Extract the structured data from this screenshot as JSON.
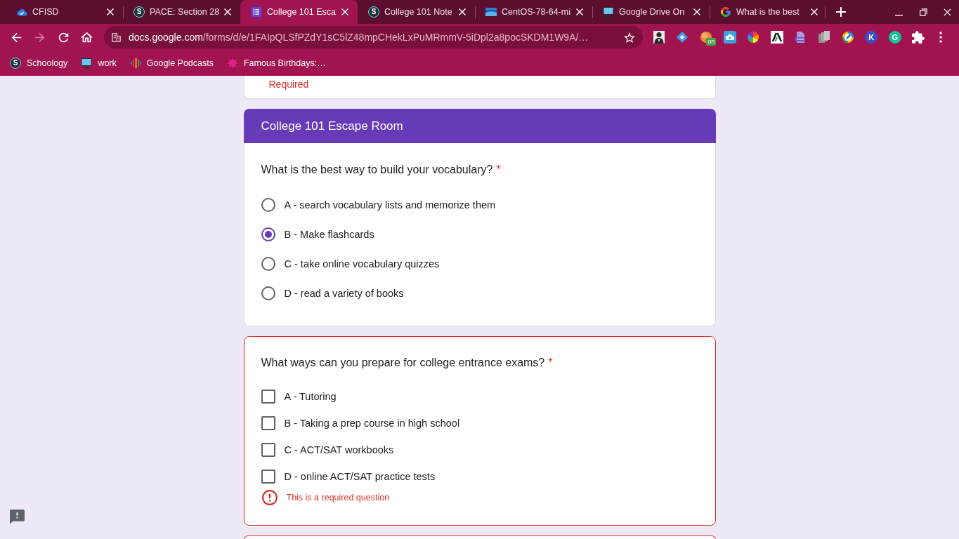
{
  "browser": {
    "tabs": [
      {
        "title": "CFISD",
        "kind": "cloud",
        "selected": false
      },
      {
        "title": "PACE: Section 28",
        "kind": "letter",
        "glyph": "S",
        "selected": false
      },
      {
        "title": "College 101 Esca",
        "kind": "list",
        "selected": true
      },
      {
        "title": "College 101 Note",
        "kind": "letter",
        "glyph": "S",
        "selected": false
      },
      {
        "title": "CentOS-78-64-mi",
        "kind": "landscape",
        "selected": false
      },
      {
        "title": "Google Drive On",
        "kind": "monitor",
        "selected": false
      },
      {
        "title": "What is the best",
        "kind": "g-logo",
        "selected": false
      }
    ],
    "nav_buttons": [
      {
        "kind": "back",
        "disabled": false
      },
      {
        "kind": "forward",
        "disabled": true
      },
      {
        "kind": "reload",
        "disabled": false
      },
      {
        "kind": "home",
        "disabled": false
      }
    ],
    "address": {
      "host": "docs.google.com",
      "path": "/forms/d/e/1FAIpQLSfPZdY1sC5lZ48mpCHekLxPuMRmmV-5iDpl2a8pocSKDM1W9A/…"
    },
    "extensions": [
      {
        "kind": "mascot"
      },
      {
        "kind": "diamond"
      },
      {
        "kind": "orb",
        "badge": "on"
      },
      {
        "kind": "cloud"
      },
      {
        "kind": "wheel"
      },
      {
        "kind": "peak"
      },
      {
        "kind": "document"
      },
      {
        "kind": "pages"
      },
      {
        "kind": "pencil"
      },
      {
        "kind": "letter",
        "glyph": "K",
        "color": "#3b4fc4"
      },
      {
        "kind": "letter",
        "glyph": "G",
        "color": "#15c39a"
      }
    ],
    "bookmarks": [
      {
        "label": "Schoology",
        "kind": "letter",
        "glyph": "S"
      },
      {
        "label": "work",
        "kind": "monitor"
      },
      {
        "label": "Google Podcasts",
        "kind": "bars"
      },
      {
        "label": "Famous Birthdays:…",
        "kind": "burst"
      }
    ]
  },
  "form": {
    "previous_card": {
      "note": "Required"
    },
    "questions": [
      {
        "kind": "radio",
        "section_title": "College 101 Escape Room",
        "title": "What is the best way to build your vocabulary?",
        "required_mark": "*",
        "invalid": false,
        "options": [
          {
            "label": "A - search vocabulary lists and memorize them",
            "selected": false
          },
          {
            "label": "B - Make flashcards",
            "selected": true
          },
          {
            "label": "C - take online vocabulary quizzes",
            "selected": false
          },
          {
            "label": "D - read a variety of books",
            "selected": false
          }
        ]
      },
      {
        "kind": "checkbox",
        "title": "What ways can you prepare for college entrance exams?",
        "required_mark": "*",
        "invalid": true,
        "error": "This is a required question",
        "options": [
          {
            "label": "A - Tutoring",
            "checked": false
          },
          {
            "label": "B - Taking a prep course in high school",
            "checked": false
          },
          {
            "label": "C - ACT/SAT workbooks",
            "checked": false
          },
          {
            "label": "D - online ACT/SAT practice tests",
            "checked": false
          }
        ]
      }
    ],
    "next_card": {
      "invalid": true
    }
  }
}
